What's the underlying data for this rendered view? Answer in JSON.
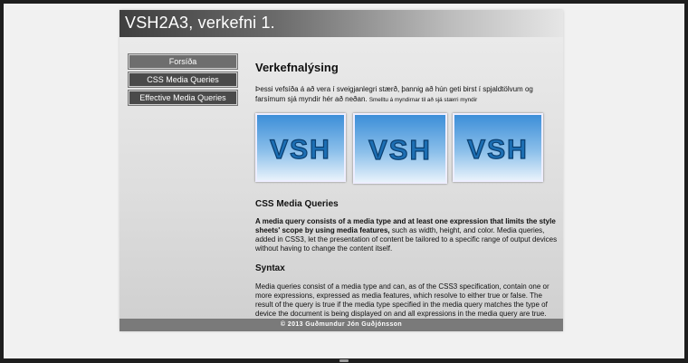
{
  "site": {
    "title": "VSH2A3, verkefni 1.",
    "nav": [
      {
        "label": "Forsíða"
      },
      {
        "label": "CSS Media Queries"
      },
      {
        "label": "Effective Media Queries"
      }
    ],
    "main": {
      "heading": "Verkefnalýsing",
      "intro": "Þessi vefsíða á að vera í sveigjanlegri stærð, þannig að hún geti birst í spjaldtölvum og farsímum sjá myndir hér að neðan.",
      "intro_small": "Smelltu á myndirnar til að sjá stærri myndir",
      "thumbs": [
        {
          "text": "VSH",
          "icon": "vsh-logo-image"
        },
        {
          "text": "VSH",
          "icon": "vsh-logo-image"
        },
        {
          "text": "VSH",
          "icon": "vsh-logo-image"
        }
      ],
      "section1": {
        "heading": "CSS Media Queries",
        "bold": "A media query consists of a media type and at least one expression that limits the style sheets' scope by using media features,",
        "rest": " such as width, height, and color. Media queries, added in CSS3, let the presentation of content be tailored to a specific range of output devices without having to change the content itself."
      },
      "section2": {
        "heading": "Syntax",
        "text": "Media queries consist of a media type and can, as of the CSS3 specification, contain one or more expressions, expressed as media features, which resolve to either true or false. The result of the query is true if the media type specified in the media query matches the type of device the document is being displayed on and all expressions in the media query are true."
      }
    },
    "footer": "© 2013 Guðmundur Jón Guðjónsson"
  },
  "colors": {
    "header_dark": "#3f3f3f",
    "nav_button": "#4a4a4a",
    "footer_bg": "#7a7a7a",
    "thumb_blue": "#3c8ed8"
  }
}
